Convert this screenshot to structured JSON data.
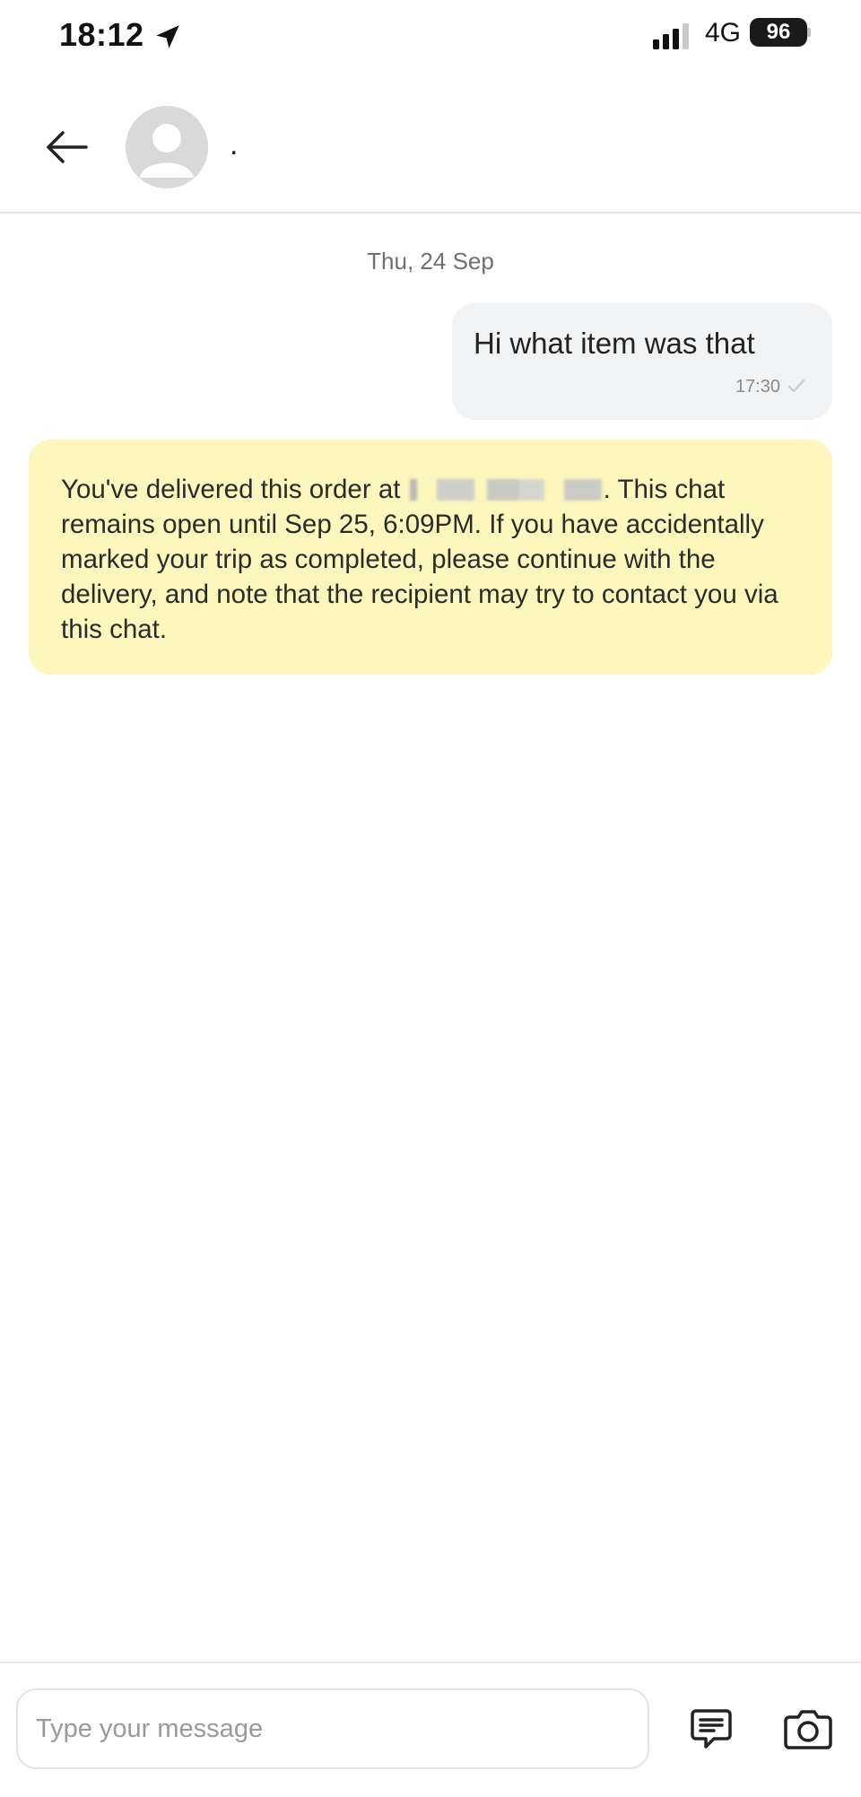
{
  "status_bar": {
    "time": "18:12",
    "location_icon": "location-arrow-icon",
    "signal_icon": "cellular-signal-icon",
    "network": "4G",
    "battery": "96"
  },
  "header": {
    "back_icon": "arrow-left-icon",
    "avatar_icon": "person-placeholder-icon",
    "contact_name": "."
  },
  "messages": {
    "date_separator": "Thu, 24 Sep",
    "outgoing": {
      "text": "Hi what item was that",
      "time": "17:30",
      "status_icon": "check-icon"
    },
    "system_notice": {
      "text_before": "You've delivered this order at ",
      "redacted_icon": "redacted-address-blur",
      "text_after": ". This chat remains open until Sep 25, 6:09PM. If you have accidentally marked your trip as completed, please continue with the delivery, and note that the recipient may try to contact you via this chat.",
      "background_color": "#fdf6bd"
    }
  },
  "composer": {
    "placeholder": "Type your message",
    "value": "",
    "quick_reply_icon": "message-template-icon",
    "camera_icon": "camera-icon"
  }
}
